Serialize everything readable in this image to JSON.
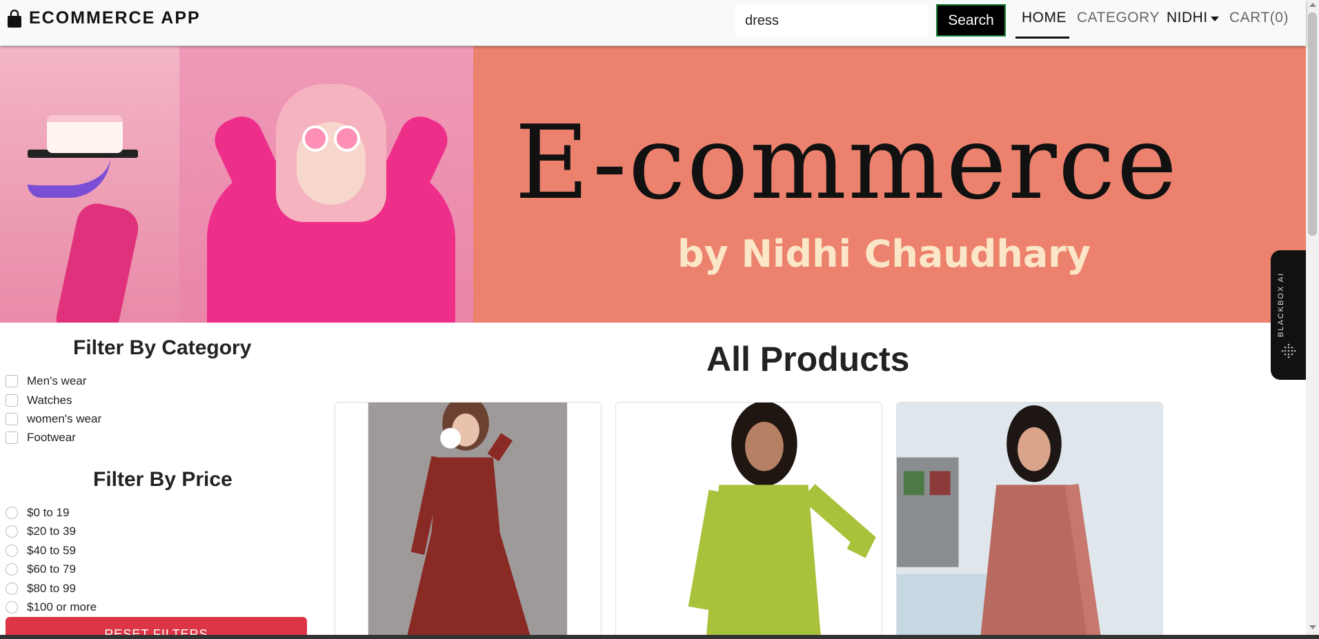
{
  "navbar": {
    "brand": "ECOMMERCE APP",
    "search_value": "dress",
    "search_button": "Search",
    "links": {
      "home": "HOME",
      "category": "CATEGORY",
      "user": "NIDHI",
      "cart": "CART(0)"
    }
  },
  "banner": {
    "title": "E-commerce",
    "subtitle": "by Nidhi Chaudhary"
  },
  "filters": {
    "category_title": "Filter By Category",
    "categories": [
      "Men's wear",
      "Watches",
      "women's wear",
      "Footwear"
    ],
    "price_title": "Filter By Price",
    "prices": [
      "$0 to 19",
      "$20 to 39",
      "$40 to 59",
      "$60 to 79",
      "$80 to 99",
      "$100 or more"
    ],
    "reset_button": "RESET FILTERS"
  },
  "products": {
    "title": "All Products"
  },
  "widget": {
    "label": "BLACKBOX AI"
  },
  "colors": {
    "banner_bg": "#ec826e",
    "reset_button": "#dc3545",
    "navbar_bg": "#f8f9fa"
  }
}
